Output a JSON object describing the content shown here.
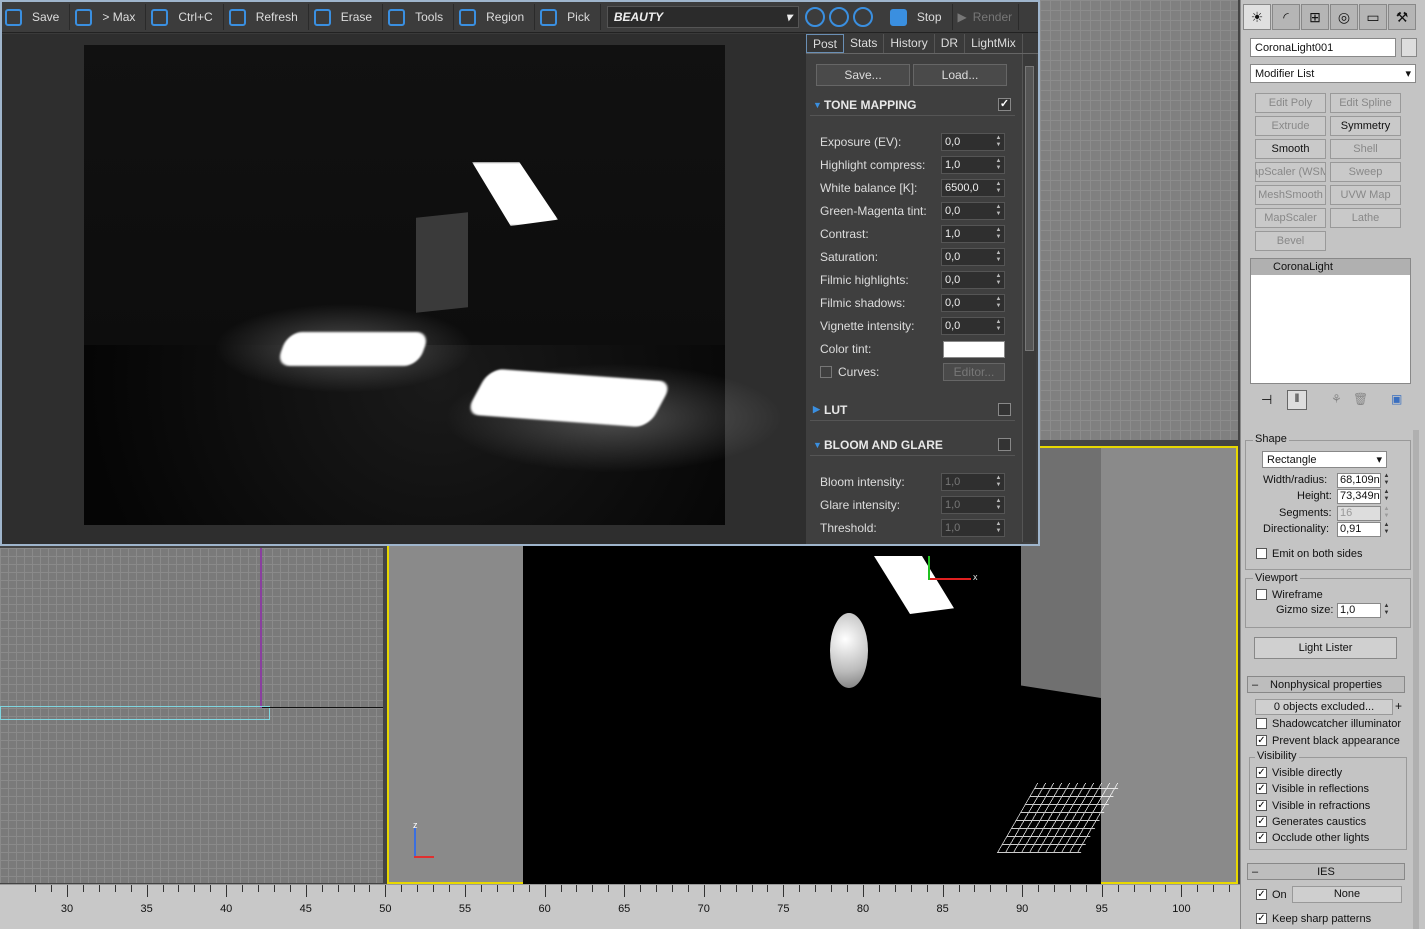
{
  "vfb": {
    "toolbar": [
      {
        "label": "Save",
        "icon": "save-icon"
      },
      {
        "label": "> Max",
        "icon": "send-to-max-icon"
      },
      {
        "label": "Ctrl+C",
        "icon": "copy-icon"
      },
      {
        "label": "Refresh",
        "icon": "refresh-icon"
      },
      {
        "label": "Erase",
        "icon": "erase-icon"
      },
      {
        "label": "Tools",
        "icon": "gear-icon"
      },
      {
        "label": "Region",
        "icon": "region-icon"
      },
      {
        "label": "Pick",
        "icon": "hand-icon"
      }
    ],
    "channel": "BEAUTY",
    "stop_label": "Stop",
    "render_label": "Render",
    "tabs": [
      "Post",
      "Stats",
      "History",
      "DR",
      "LightMix"
    ],
    "save_btn": "Save...",
    "load_btn": "Load...",
    "tone_mapping": {
      "title": "TONE MAPPING",
      "checked": "✓",
      "rows": [
        {
          "label": "Exposure (EV):",
          "value": "0,0"
        },
        {
          "label": "Highlight compress:",
          "value": "1,0"
        },
        {
          "label": "White balance [K]:",
          "value": "6500,0"
        },
        {
          "label": "Green-Magenta tint:",
          "value": "0,0"
        },
        {
          "label": "Contrast:",
          "value": "1,0"
        },
        {
          "label": "Saturation:",
          "value": "0,0"
        },
        {
          "label": "Filmic highlights:",
          "value": "0,0"
        },
        {
          "label": "Filmic shadows:",
          "value": "0,0"
        },
        {
          "label": "Vignette intensity:",
          "value": "0,0"
        }
      ],
      "color_tint": "Color tint:",
      "color_tint_value": "#ffffff",
      "curves": "Curves:",
      "editor": "Editor..."
    },
    "lut_title": "LUT",
    "bloom": {
      "title": "BLOOM AND GLARE",
      "rows": [
        {
          "label": "Bloom intensity:",
          "value": "1,0"
        },
        {
          "label": "Glare intensity:",
          "value": "1,0"
        },
        {
          "label": "Threshold:",
          "value": "1,0"
        }
      ]
    }
  },
  "cmd": {
    "object_name": "CoronaLight001",
    "modifier_list": "Modifier List",
    "modifiers": [
      {
        "label": "Edit Poly",
        "on": false
      },
      {
        "label": "Edit Spline",
        "on": false
      },
      {
        "label": "Extrude",
        "on": false
      },
      {
        "label": "Symmetry",
        "on": true
      },
      {
        "label": "Smooth",
        "on": true
      },
      {
        "label": "Shell",
        "on": false
      },
      {
        "label": "apScaler (WSM",
        "on": false
      },
      {
        "label": "Sweep",
        "on": false
      },
      {
        "label": "MeshSmooth",
        "on": false
      },
      {
        "label": "UVW Map",
        "on": false
      },
      {
        "label": "MapScaler",
        "on": false
      },
      {
        "label": "Lathe",
        "on": false
      },
      {
        "label": "Bevel",
        "on": false
      }
    ],
    "stack_item": "CoronaLight",
    "shape": {
      "title": "Shape",
      "type": "Rectangle",
      "width_label": "Width/radius:",
      "width": "68,109n",
      "height_label": "Height:",
      "height": "73,349n",
      "segments_label": "Segments:",
      "segments": "16",
      "dir_label": "Directionality:",
      "dir": "0,91",
      "emit_both": "Emit on both sides"
    },
    "viewport": {
      "title": "Viewport",
      "wireframe": "Wireframe",
      "gizmo_label": "Gizmo size:",
      "gizmo": "1,0"
    },
    "light_lister": "Light Lister",
    "nonphysical": {
      "title": "Nonphysical properties",
      "excluded": "0 objects excluded...",
      "shadowcatcher": "Shadowcatcher illuminator",
      "prevent_black": "Prevent black appearance",
      "visibility": "Visibility",
      "vis_items": [
        "Visible directly",
        "Visible in reflections",
        "Visible in refractions",
        "Generates caustics",
        "Occlude other lights"
      ]
    },
    "ies": {
      "title": "IES",
      "on": "On",
      "none": "None",
      "keep": "Keep sharp patterns"
    }
  },
  "ruler": [
    "30",
    "35",
    "40",
    "45",
    "50",
    "55",
    "60",
    "65",
    "70",
    "75",
    "80",
    "85",
    "90",
    "95",
    "100"
  ],
  "axis": {
    "z": "z",
    "x": "x"
  }
}
